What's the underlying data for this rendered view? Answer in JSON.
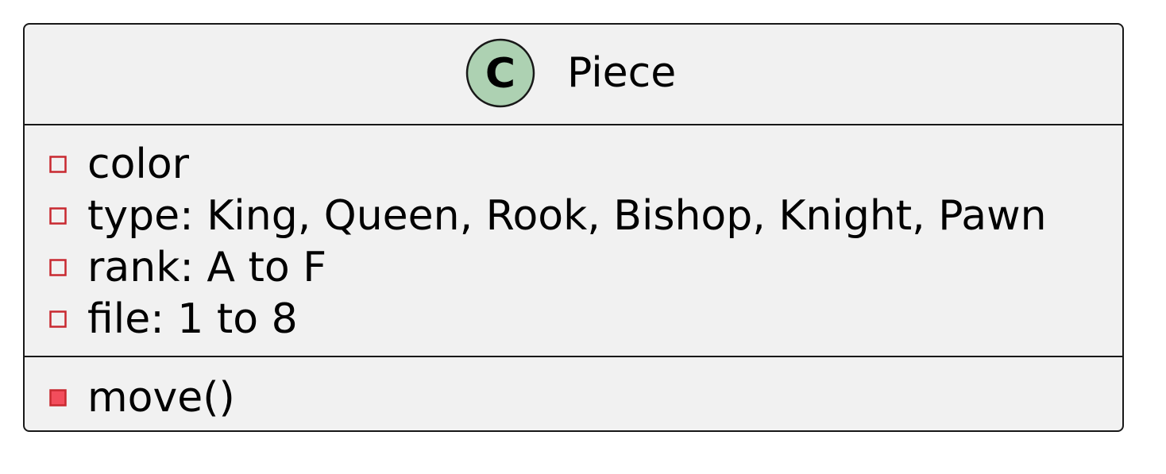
{
  "class": {
    "stereotype_letter": "C",
    "name": "Piece",
    "badge_color": "#ADD1B2",
    "attributes": [
      {
        "label": "color",
        "visibility": "private"
      },
      {
        "label": "type: King, Queen, Rook, Bishop, Knight, Pawn",
        "visibility": "private"
      },
      {
        "label": "rank: A to F",
        "visibility": "private"
      },
      {
        "label": "file: 1 to 8",
        "visibility": "private"
      }
    ],
    "methods": [
      {
        "label": "move()",
        "visibility": "private"
      }
    ]
  },
  "colors": {
    "box_fill": "#F1F1F1",
    "border": "#181818",
    "private_marker": "#C82930",
    "private_method_fill": "#F24D5C"
  }
}
